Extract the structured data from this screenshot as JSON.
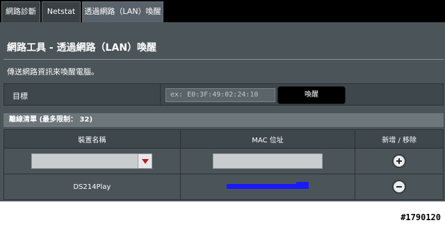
{
  "tabs": [
    {
      "label": "網路診斷",
      "active": false
    },
    {
      "label": "Netstat",
      "active": false
    },
    {
      "label": "透過網路（LAN）喚醒",
      "active": true
    }
  ],
  "page": {
    "title": "網路工具 - 透過網路（LAN）喚醒",
    "description": "傳送網路資訊來喚醒電腦。"
  },
  "target": {
    "label": "目標",
    "placeholder": "ex: E0:3F:49:02:24:10",
    "wake_label": "喚醒"
  },
  "offline_list": {
    "header": "離線清單 (最多限制： 32)",
    "columns": [
      "裝置名稱",
      "MAC 位址",
      "新增 / 移除"
    ],
    "rows": [
      {
        "device": "DS214Play",
        "mac_redacted": true
      }
    ]
  },
  "icons": {
    "add": "plus-circle-icon",
    "remove": "minus-circle-icon",
    "dropdown": "dropdown-arrow-icon"
  },
  "colors": {
    "panel": "#4a5459",
    "tab_bar": "#000000",
    "accent_arrow": "#b0202a",
    "redaction": "#1a1aff"
  },
  "watermark": "#1790120"
}
